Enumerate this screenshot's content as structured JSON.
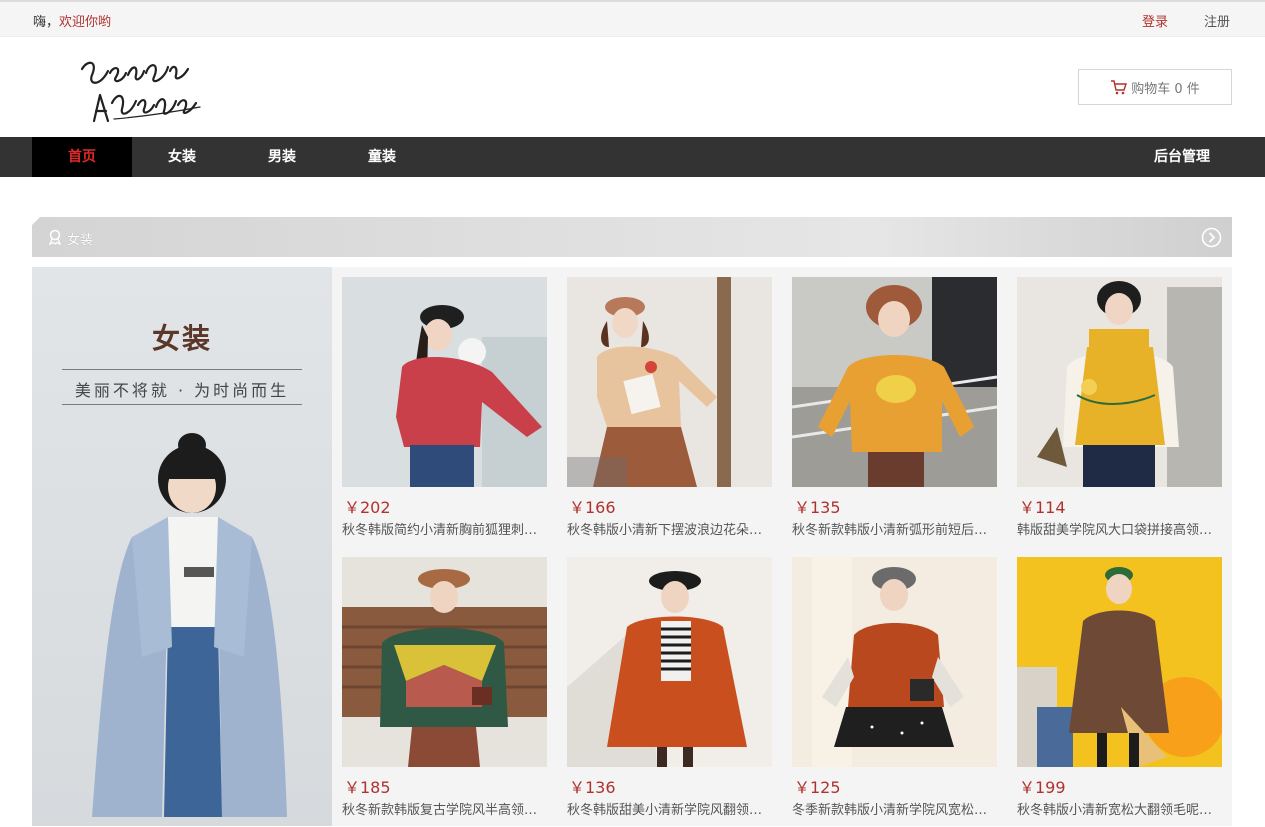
{
  "topbar": {
    "greeting_prefix": "嗨，",
    "greeting_highlight": "欢迎你哟",
    "login": "登录",
    "register": "注册"
  },
  "header": {
    "cart_label": "购物车 0 件"
  },
  "nav": {
    "items": [
      "首页",
      "女装",
      "男装",
      "童装"
    ],
    "active_index": 0,
    "admin": "后台管理"
  },
  "section": {
    "title": "女装"
  },
  "banner": {
    "title": "女装",
    "slogan": "美丽不将就 · 为时尚而生"
  },
  "products": [
    {
      "price": "￥202",
      "name": "秋冬韩版简约小清新胸前狐狸刺绣毛衣"
    },
    {
      "price": "￥166",
      "name": "秋冬韩版小清新下摆波浪边花朵毛衣"
    },
    {
      "price": "￥135",
      "name": "秋冬新款韩版小清新弧形前短后长毛衣"
    },
    {
      "price": "￥114",
      "name": "韩版甜美学院风大口袋拼接高领马甲"
    },
    {
      "price": "￥185",
      "name": "秋冬新款韩版复古学院风半高领撞色毛衣"
    },
    {
      "price": "￥136",
      "name": "秋冬韩版甜美小清新学院风翻领外套"
    },
    {
      "price": "￥125",
      "name": "冬季新款韩版小清新学院风宽松外套"
    },
    {
      "price": "￥199",
      "name": "秋冬韩版小清新宽松大翻领毛呢外套"
    }
  ],
  "colors": {
    "accent_red": "#b0322e",
    "nav_bg": "#333333",
    "nav_active_text": "#e02a2a"
  }
}
